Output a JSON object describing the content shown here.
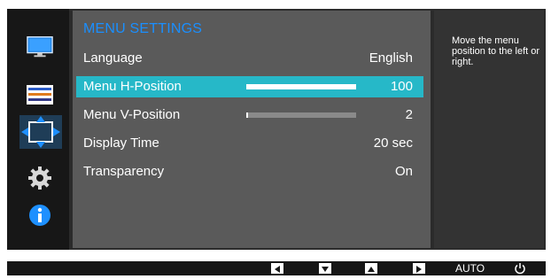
{
  "menu": {
    "title": "MENU SETTINGS",
    "items": [
      {
        "label": "Language",
        "value": "English"
      },
      {
        "label": "Menu H-Position",
        "value": "100",
        "slider": 1.0
      },
      {
        "label": "Menu V-Position",
        "value": "2",
        "slider": 0.02
      },
      {
        "label": "Display Time",
        "value": "20 sec"
      },
      {
        "label": "Transparency",
        "value": "On"
      }
    ],
    "selected_index": 1
  },
  "info": {
    "text": "Move the menu position to the left or right."
  },
  "sidebar": {
    "icons": [
      "monitor-icon",
      "color-bars-icon",
      "move-arrows-icon",
      "gear-icon",
      "info-icon"
    ],
    "selected": "move-arrows-icon"
  },
  "bottom": {
    "keys": [
      "left-key",
      "down-key",
      "up-key",
      "right-key"
    ],
    "auto_label": "AUTO",
    "power": "power-icon"
  },
  "colors": {
    "accent_title": "#1a8fff",
    "selection": "#26b8c8",
    "info_icon": "#1e90ff"
  }
}
